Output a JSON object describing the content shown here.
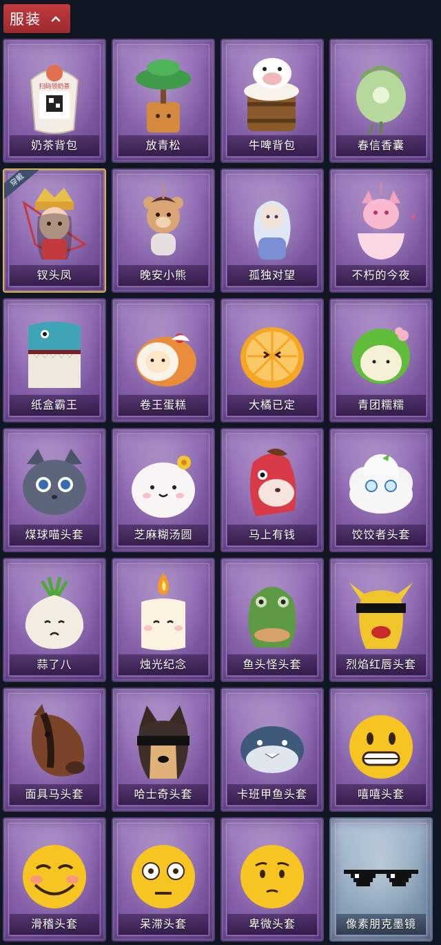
{
  "header": {
    "title": "服装",
    "icon": "chevron-up-icon"
  },
  "equipped_tag": "穿戴",
  "items": [
    {
      "label": "奶茶背包",
      "art": "milk-tea-bag",
      "qr_text": "扫码领奶茶"
    },
    {
      "label": "放青松",
      "art": "pine"
    },
    {
      "label": "牛啤背包",
      "art": "cow-mug"
    },
    {
      "label": "春信香囊",
      "art": "sachet"
    },
    {
      "label": "钗头凤",
      "art": "phoenix-girl",
      "equipped": true
    },
    {
      "label": "晚安小熊",
      "art": "bear"
    },
    {
      "label": "孤独对望",
      "art": "figurine"
    },
    {
      "label": "不朽的今夜",
      "art": "fox-bowl"
    },
    {
      "label": "纸盒霸王",
      "art": "box-dino"
    },
    {
      "label": "卷王蛋糕",
      "art": "roll-cake"
    },
    {
      "label": "大橘已定",
      "art": "orange"
    },
    {
      "label": "青团糯糯",
      "art": "green-mochi"
    },
    {
      "label": "煤球喵头套",
      "art": "cat-head"
    },
    {
      "label": "芝麻糊汤圆",
      "art": "dumpling"
    },
    {
      "label": "马上有钱",
      "art": "red-horse"
    },
    {
      "label": "饺饺者头套",
      "art": "cloud-dumpling"
    },
    {
      "label": "蒜了八",
      "art": "garlic"
    },
    {
      "label": "烛光纪念",
      "art": "candle"
    },
    {
      "label": "鱼头怪头套",
      "art": "fish-mask"
    },
    {
      "label": "烈焰红唇头套",
      "art": "yellow-mask"
    },
    {
      "label": "面具马头套",
      "art": "horse-mask"
    },
    {
      "label": "哈士奇头套",
      "art": "husky"
    },
    {
      "label": "卡班甲鱼头套",
      "art": "fish-head"
    },
    {
      "label": "嘻嘻头套",
      "art": "grin"
    },
    {
      "label": "滑稽头套",
      "art": "funny"
    },
    {
      "label": "呆滞头套",
      "art": "stare"
    },
    {
      "label": "卑微头套",
      "art": "humble"
    },
    {
      "label": "像素朋克墨镜",
      "art": "pixel-glasses",
      "special": true
    }
  ]
}
